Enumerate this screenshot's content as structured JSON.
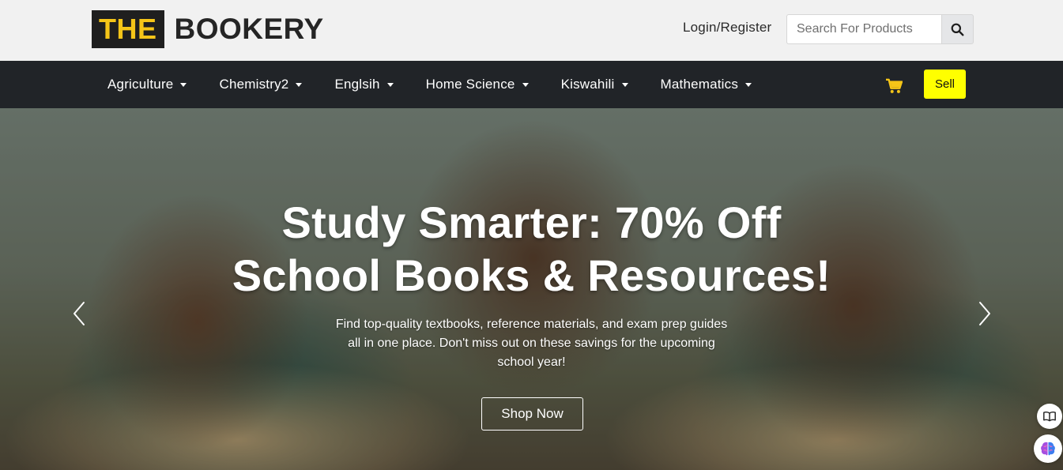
{
  "header": {
    "logo_the": "THE",
    "logo_bookery": "BOOKERY",
    "login_label": "Login/Register",
    "search": {
      "placeholder": "Search For Products",
      "value": ""
    }
  },
  "nav": {
    "items": [
      {
        "label": "Agriculture"
      },
      {
        "label": "Chemistry2"
      },
      {
        "label": "Englsih"
      },
      {
        "label": "Home Science"
      },
      {
        "label": "Kiswahili"
      },
      {
        "label": "Mathematics"
      }
    ],
    "sell_label": "Sell",
    "cart_icon": "shopping-cart-icon"
  },
  "hero": {
    "title_line1": "Study Smarter: 70% Off",
    "title_line2": "School Books & Resources!",
    "subtitle_line1": "Find top-quality textbooks, reference materials, and exam prep guides",
    "subtitle_line2": "all in one place. Don't miss out on these savings for the upcoming",
    "subtitle_line3": "school year!",
    "cta_label": "Shop Now",
    "prev_icon": "chevron-left-icon",
    "next_icon": "chevron-right-icon"
  },
  "colors": {
    "brand_yellow": "#f5c518",
    "sell_yellow": "#ffff00",
    "navbar_bg": "#212428",
    "topbar_bg": "#f1f1f1",
    "cart_color": "#f5c518"
  },
  "widgets": {
    "book_icon": "book-open-icon",
    "brain_icon": "brain-icon"
  }
}
